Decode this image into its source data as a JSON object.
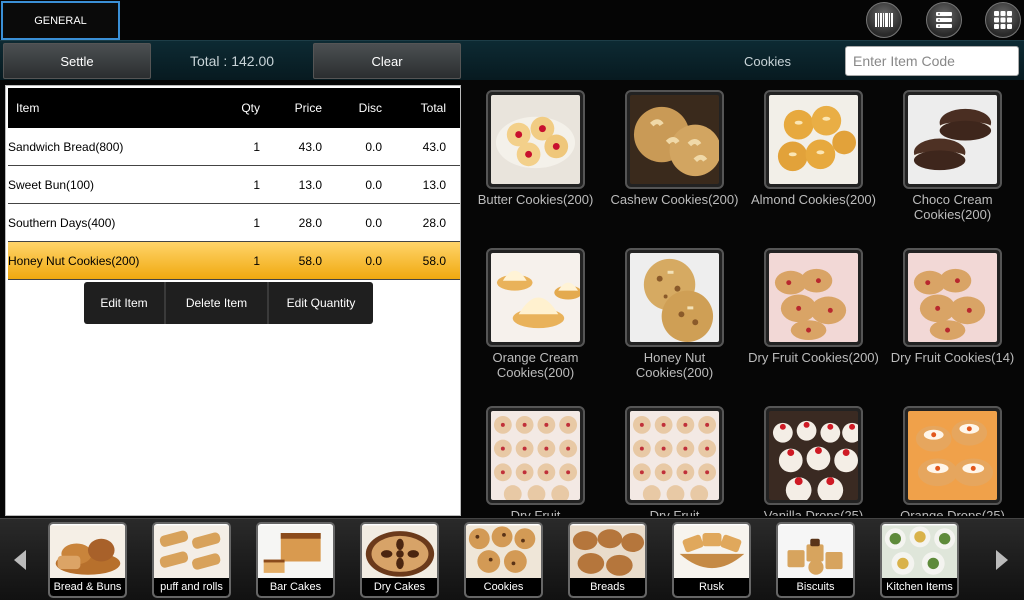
{
  "top": {
    "tab_label": "GENERAL",
    "icons": [
      "barcode-icon",
      "list-icon",
      "grid-icon"
    ]
  },
  "bar": {
    "settle_label": "Settle",
    "total_label": "Total : 142.00",
    "clear_label": "Clear",
    "category_label": "Cookies",
    "item_code_placeholder": "Enter Item Code"
  },
  "order": {
    "headers": {
      "item": "Item",
      "qty": "Qty",
      "price": "Price",
      "disc": "Disc",
      "total": "Total"
    },
    "rows": [
      {
        "item": "Sandwich Bread(800)",
        "qty": "1",
        "price": "43.0",
        "disc": "0.0",
        "total": "43.0"
      },
      {
        "item": "Sweet Bun(100)",
        "qty": "1",
        "price": "13.0",
        "disc": "0.0",
        "total": "13.0"
      },
      {
        "item": "Southern Days(400)",
        "qty": "1",
        "price": "28.0",
        "disc": "0.0",
        "total": "28.0"
      },
      {
        "item": "Honey Nut Cookies(200)",
        "qty": "1",
        "price": "58.0",
        "disc": "0.0",
        "total": "58.0"
      }
    ],
    "selected_row": 3,
    "context_menu": [
      "Edit Item",
      "Delete Item",
      "Edit Quantity"
    ]
  },
  "products": [
    {
      "name": "Butter Cookies(200)"
    },
    {
      "name": "Cashew Cookies(200)"
    },
    {
      "name": "Almond Cookies(200)"
    },
    {
      "name": "Choco Cream Cookies(200)"
    },
    {
      "name": "Orange Cream Cookies(200)"
    },
    {
      "name": "Honey Nut Cookies(200)"
    },
    {
      "name": "Dry Fruit Cookies(200)"
    },
    {
      "name": "Dry Fruit Cookies(14)"
    },
    {
      "name": "Dry Fruit"
    },
    {
      "name": "Dry Fruit"
    },
    {
      "name": "Vanilla Drops(25)"
    },
    {
      "name": "Orange Drops(25)"
    }
  ],
  "categories": [
    {
      "name": "Bread & Buns"
    },
    {
      "name": "puff and rolls"
    },
    {
      "name": "Bar Cakes"
    },
    {
      "name": "Dry Cakes"
    },
    {
      "name": "Cookies"
    },
    {
      "name": "Breads"
    },
    {
      "name": "Rusk"
    },
    {
      "name": "Biscuits"
    },
    {
      "name": "Kitchen Items"
    }
  ],
  "colors": {
    "accent_blue": "#3a8fd6",
    "selected_row": "#f0a90f",
    "bar_teal": "#0d2a33"
  }
}
